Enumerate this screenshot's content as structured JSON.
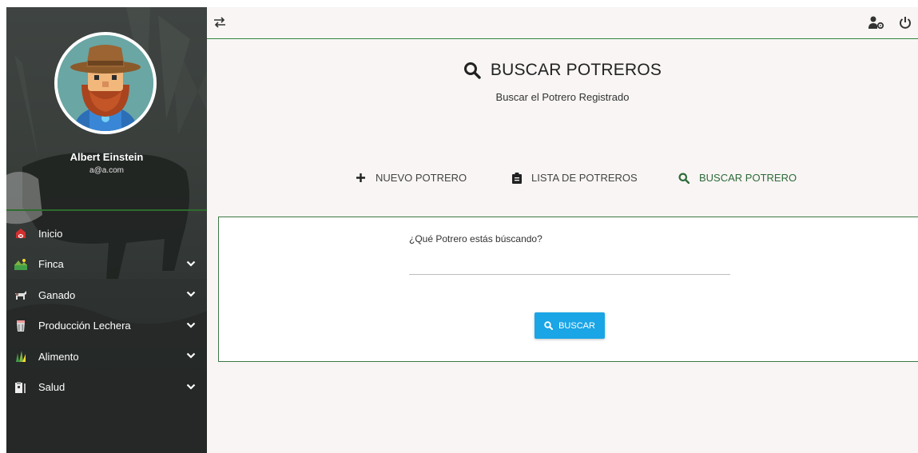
{
  "sidebar": {
    "user_name": "Albert Einstein",
    "user_email": "a@a.com",
    "avatar_icon": "farmer-avatar",
    "items": [
      {
        "label": "Inicio",
        "icon": "barn-icon",
        "has_submenu": false
      },
      {
        "label": "Finca",
        "icon": "field-icon",
        "has_submenu": true
      },
      {
        "label": "Ganado",
        "icon": "cattle-icon",
        "has_submenu": true
      },
      {
        "label": "Producción Lechera",
        "icon": "milk-icon",
        "has_submenu": true
      },
      {
        "label": "Alimento",
        "icon": "grass-icon",
        "has_submenu": true
      },
      {
        "label": "Salud",
        "icon": "health-icon",
        "has_submenu": true
      }
    ]
  },
  "topbar": {
    "toggle_icon": "swap-icon",
    "user_settings_icon": "user-gear-icon",
    "logout_icon": "power-icon"
  },
  "page": {
    "title": "BUSCAR POTREROS",
    "subtitle": "Buscar el Potrero Registrado"
  },
  "nav": {
    "new": "NUEVO POTRERO",
    "list": "LISTA DE POTREROS",
    "search": "BUSCAR POTRERO"
  },
  "form": {
    "label": "¿Qué Potrero estás búscando?",
    "value": "",
    "button": "BUSCAR"
  },
  "colors": {
    "accent_green": "#2e6b3a",
    "button_blue": "#1aa5e6",
    "background": "#f8f5f4"
  }
}
